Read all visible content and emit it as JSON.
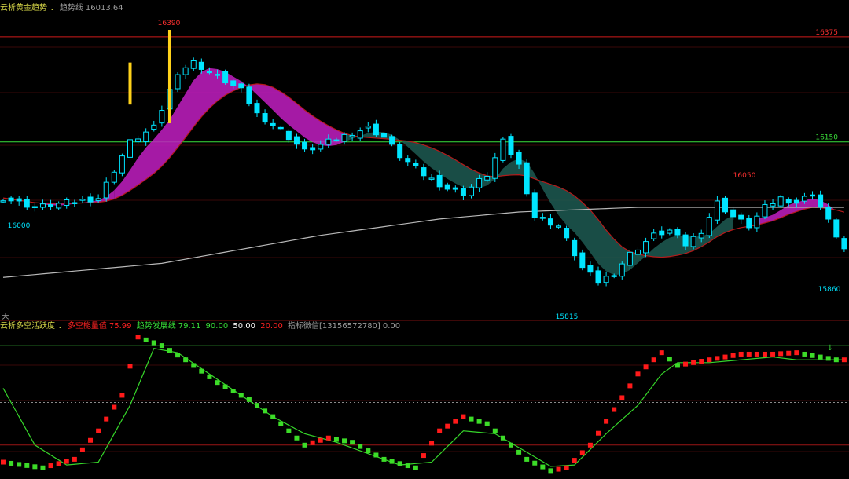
{
  "main_header": {
    "indicator_name": "云析黄金趋势",
    "trend_label": "趋势线",
    "trend_value": "16013.64"
  },
  "sub_header": {
    "indicator_name": "云析多空活跃度",
    "line1_label": "多空能量值",
    "line1_value": "75.99",
    "line2_label": "趋势发展线",
    "line2_value": "79.11",
    "level_high": "90.00",
    "level_mid": "50.00",
    "level_low": "20.00",
    "note": "指标微信[13156572780]",
    "note_value": "0.00"
  },
  "labels": {
    "period": "天"
  },
  "colors": {
    "up": "#00e5ff",
    "down": "#00e5ff",
    "bull_cloud": "#c21fc2",
    "bear_cloud": "#1d5a52",
    "ma_long": "#b9b9b9",
    "level_red": "#d01a1a",
    "level_green": "#3adf3a",
    "energy_up": "#ff1a1a",
    "energy_down": "#3cdc28",
    "trend_line": "#36d62a"
  },
  "chart_data": [
    {
      "type": "candlestick",
      "title": "",
      "ylim": [
        15815,
        16390
      ],
      "price_labels": [
        {
          "text": "16390",
          "value": 16390,
          "kind": "high"
        },
        {
          "text": "16375",
          "value": 16375,
          "kind": "axis-level"
        },
        {
          "text": "16150",
          "value": 16150,
          "kind": "axis-level"
        },
        {
          "text": "16050",
          "value": 16050,
          "kind": "high"
        },
        {
          "text": "16000",
          "value": 16000,
          "kind": "low"
        },
        {
          "text": "15860",
          "value": 15860,
          "kind": "low"
        },
        {
          "text": "15815",
          "value": 15815,
          "kind": "low"
        }
      ],
      "levels": [
        {
          "value": 16375,
          "color": "red"
        },
        {
          "value": 16150,
          "color": "green"
        }
      ],
      "close_path": [
        [
          0,
          16030
        ],
        [
          4,
          16010
        ],
        [
          8,
          16020
        ],
        [
          12,
          16030
        ],
        [
          16,
          16150
        ],
        [
          19,
          16180
        ],
        [
          22,
          16300
        ],
        [
          24,
          16320
        ],
        [
          27,
          16290
        ],
        [
          30,
          16260
        ],
        [
          32,
          16210
        ],
        [
          35,
          16175
        ],
        [
          38,
          16130
        ],
        [
          41,
          16150
        ],
        [
          44,
          16170
        ],
        [
          46,
          16180
        ],
        [
          48,
          16160
        ],
        [
          50,
          16120
        ],
        [
          53,
          16080
        ],
        [
          56,
          16050
        ],
        [
          58,
          16040
        ],
        [
          61,
          16080
        ],
        [
          63,
          16150
        ],
        [
          65,
          16100
        ],
        [
          67,
          15990
        ],
        [
          70,
          15970
        ],
        [
          73,
          15880
        ],
        [
          75,
          15850
        ],
        [
          77,
          15870
        ],
        [
          79,
          15910
        ],
        [
          82,
          15950
        ],
        [
          84,
          15960
        ],
        [
          86,
          15930
        ],
        [
          88,
          15960
        ],
        [
          90,
          16020
        ],
        [
          92,
          15990
        ],
        [
          94,
          15970
        ],
        [
          96,
          16010
        ],
        [
          98,
          16030
        ],
        [
          100,
          16020
        ],
        [
          102,
          16040
        ],
        [
          104,
          15980
        ],
        [
          106,
          15920
        ]
      ],
      "trend_line": [
        [
          0,
          15860
        ],
        [
          20,
          15890
        ],
        [
          40,
          15950
        ],
        [
          55,
          15985
        ],
        [
          65,
          16000
        ],
        [
          80,
          16010
        ],
        [
          106,
          16010
        ]
      ],
      "bull_segments": [
        [
          0,
          14
        ],
        [
          14,
          43
        ],
        [
          95,
          105
        ]
      ],
      "bear_segments": [
        [
          43,
          92
        ]
      ]
    },
    {
      "type": "line",
      "title": "",
      "ylim": [
        0,
        100
      ],
      "levels": [
        90,
        50,
        20
      ],
      "energy_path": [
        [
          0,
          8
        ],
        [
          5,
          4
        ],
        [
          9,
          10
        ],
        [
          12,
          30
        ],
        [
          15,
          55
        ],
        [
          17,
          96
        ],
        [
          20,
          90
        ],
        [
          23,
          80
        ],
        [
          27,
          64
        ],
        [
          31,
          52
        ],
        [
          34,
          40
        ],
        [
          36,
          30
        ],
        [
          38,
          20
        ],
        [
          41,
          25
        ],
        [
          44,
          22
        ],
        [
          48,
          10
        ],
        [
          52,
          4
        ],
        [
          55,
          30
        ],
        [
          58,
          40
        ],
        [
          61,
          35
        ],
        [
          64,
          20
        ],
        [
          66,
          10
        ],
        [
          69,
          2
        ],
        [
          71,
          4
        ],
        [
          74,
          20
        ],
        [
          77,
          45
        ],
        [
          80,
          70
        ],
        [
          83,
          85
        ],
        [
          85,
          76
        ],
        [
          89,
          80
        ],
        [
          93,
          84
        ],
        [
          97,
          84
        ],
        [
          100,
          85
        ],
        [
          105,
          80
        ]
      ],
      "trend_path": [
        [
          0,
          60
        ],
        [
          4,
          20
        ],
        [
          8,
          6
        ],
        [
          12,
          8
        ],
        [
          16,
          48
        ],
        [
          19,
          88
        ],
        [
          22,
          85
        ],
        [
          26,
          70
        ],
        [
          30,
          55
        ],
        [
          34,
          40
        ],
        [
          38,
          28
        ],
        [
          42,
          22
        ],
        [
          46,
          14
        ],
        [
          50,
          6
        ],
        [
          54,
          8
        ],
        [
          58,
          30
        ],
        [
          62,
          28
        ],
        [
          66,
          15
        ],
        [
          69,
          5
        ],
        [
          72,
          6
        ],
        [
          76,
          28
        ],
        [
          80,
          48
        ],
        [
          83,
          70
        ],
        [
          85,
          78
        ],
        [
          89,
          78
        ],
        [
          93,
          80
        ],
        [
          97,
          82
        ],
        [
          100,
          80
        ],
        [
          105,
          80
        ]
      ]
    }
  ]
}
